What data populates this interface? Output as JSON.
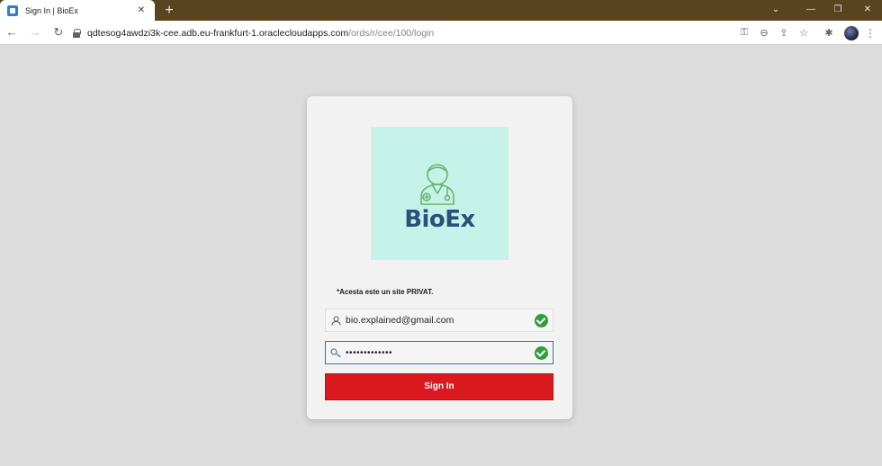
{
  "browser": {
    "tab_title": "Sign In | BioEx",
    "tab_close": "✕",
    "new_tab": "+",
    "url_host": "qdtesog4awdzi3k-cee.adb.eu-frankfurt-1.oraclecloudapps.com",
    "url_path": "/ords/r/cee/100/login",
    "controls": {
      "minimize": "—",
      "restore": "❐",
      "close": "✕"
    },
    "omni_icons": [
      "key-icon",
      "zoom-icon",
      "share-icon",
      "star-icon"
    ],
    "toolbar_icons": [
      "extensions-icon",
      "avatar",
      "kebab-menu-icon"
    ]
  },
  "login": {
    "logo_text": "BioEx",
    "notice": "*Acesta este un site PRIVAT.",
    "username_value": "bio.explained@gmail.com",
    "password_value": "•••••••••••••",
    "sign_in_label": "Sign In"
  },
  "colors": {
    "tabstrip": "#5a4420",
    "logo_bg": "#c5f3ea",
    "logo_text": "#2c4f7c",
    "logo_stroke": "#6cb56a",
    "button": "#d9191e",
    "check": "#2e9e40",
    "page_bg": "#dcdcdc"
  }
}
